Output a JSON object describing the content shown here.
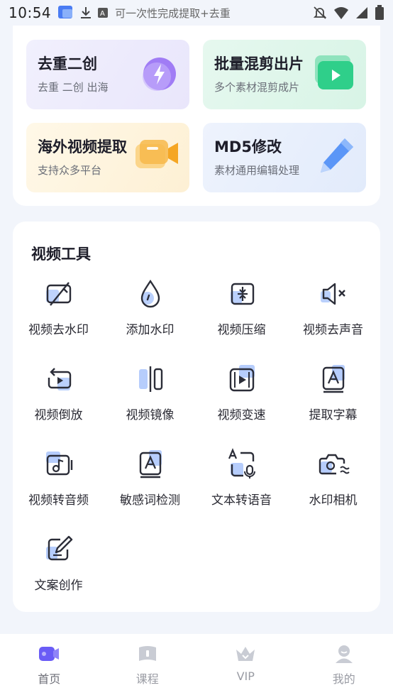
{
  "status_bar": {
    "time": "10:54",
    "notification_text": "可一次性完成提取+去重"
  },
  "features": [
    {
      "title": "去重二创",
      "subtitle": "去重  二创  出海",
      "icon": "lightning-icon"
    },
    {
      "title": "批量混剪出片",
      "subtitle": "多个素材混剪成片",
      "icon": "video-play-icon"
    },
    {
      "title": "海外视频提取",
      "subtitle": "支持众多平台",
      "icon": "video-camera-icon"
    },
    {
      "title": "MD5修改",
      "subtitle": "素材通用编辑处理",
      "icon": "pencil-icon"
    }
  ],
  "tools": {
    "title": "视频工具",
    "items": [
      {
        "label": "视频去水印",
        "icon": "video-remove-watermark-icon"
      },
      {
        "label": "添加水印",
        "icon": "water-drop-icon"
      },
      {
        "label": "视频压缩",
        "icon": "compress-icon"
      },
      {
        "label": "视频去声音",
        "icon": "mute-speaker-icon"
      },
      {
        "label": "视频倒放",
        "icon": "rewind-icon"
      },
      {
        "label": "视频镜像",
        "icon": "mirror-icon"
      },
      {
        "label": "视频变速",
        "icon": "film-speed-icon"
      },
      {
        "label": "提取字幕",
        "icon": "subtitle-icon"
      },
      {
        "label": "视频转音频",
        "icon": "video-audio-icon"
      },
      {
        "label": "敏感词检测",
        "icon": "sensitive-word-icon"
      },
      {
        "label": "文本转语音",
        "icon": "text-to-speech-icon"
      },
      {
        "label": "水印相机",
        "icon": "camera-icon"
      },
      {
        "label": "文案创作",
        "icon": "copywriting-icon"
      }
    ]
  },
  "bottom_nav": [
    {
      "label": "首页",
      "icon": "home-video-icon",
      "active": true
    },
    {
      "label": "课程",
      "icon": "course-book-icon",
      "active": false
    },
    {
      "label": "VIP",
      "icon": "vip-crown-icon",
      "active": false
    },
    {
      "label": "我的",
      "icon": "profile-icon",
      "active": false
    }
  ],
  "colors": {
    "accent": "#6a5cf6",
    "page_bg": "#f2f5fb",
    "icon_stroke": "#2b2d38",
    "icon_highlight": "#a9c4fb"
  }
}
